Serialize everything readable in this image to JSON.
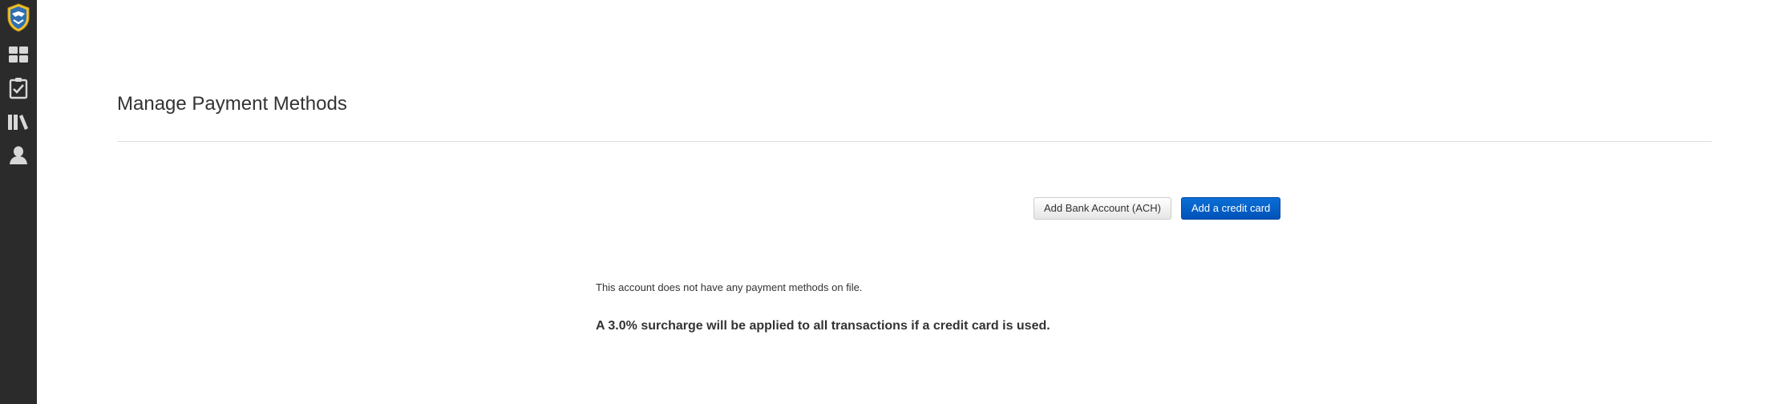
{
  "sidebar": {
    "logo_icon": "shield-logo-icon",
    "items": [
      {
        "icon": "dashboard-icon"
      },
      {
        "icon": "checklist-icon"
      },
      {
        "icon": "library-icon"
      },
      {
        "icon": "user-icon"
      }
    ]
  },
  "main": {
    "title": "Manage Payment Methods",
    "buttons": {
      "add_bank": "Add Bank Account (ACH)",
      "add_card": "Add a credit card"
    },
    "empty_message": "This account does not have any payment methods on file.",
    "surcharge_notice": "A 3.0% surcharge will be applied to all transactions if a credit card is used."
  },
  "colors": {
    "sidebar_bg": "#2b2b2b",
    "primary": "#0052b8",
    "rule": "#dddddd"
  }
}
